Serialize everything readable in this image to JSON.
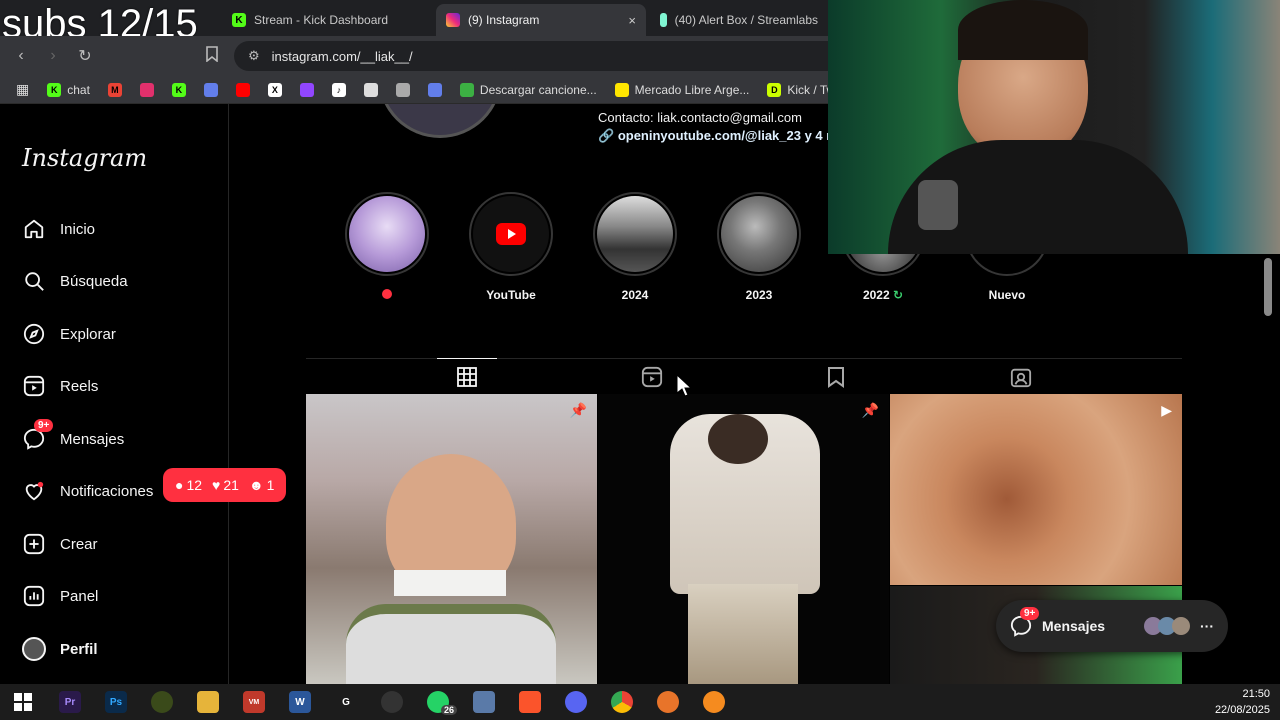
{
  "overlay": {
    "subs": "subs 12/15"
  },
  "browser": {
    "tabs": [
      {
        "title": "Stream - Kick Dashboard"
      },
      {
        "title": "(9) Instagram",
        "active": true
      },
      {
        "title": "(40) Alert Box / Streamlabs"
      }
    ],
    "tab_close": "×",
    "url": "instagram.com/__liak__/",
    "bookmarks": [
      {
        "label": "chat"
      },
      {
        "label": "Descargar cancione..."
      },
      {
        "label": "Mercado Libre Arge..."
      },
      {
        "label": "Kick / Twitch VC"
      }
    ]
  },
  "sidebar": {
    "logo": "Instagram",
    "items": [
      {
        "label": "Inicio",
        "icon": "home-icon"
      },
      {
        "label": "Búsqueda",
        "icon": "search-icon"
      },
      {
        "label": "Explorar",
        "icon": "compass-icon"
      },
      {
        "label": "Reels",
        "icon": "reels-icon"
      },
      {
        "label": "Mensajes",
        "icon": "messenger-icon",
        "badge": "9+"
      },
      {
        "label": "Notificaciones",
        "icon": "heart-icon"
      },
      {
        "label": "Crear",
        "icon": "plus-square-icon"
      },
      {
        "label": "Panel",
        "icon": "chart-icon"
      },
      {
        "label": "Perfil",
        "icon": "avatar"
      }
    ],
    "notifications": {
      "comments": "12",
      "likes": "21",
      "followers": "1"
    }
  },
  "profile": {
    "contact": "Contacto: liak.contacto@gmail.com",
    "link": "openinyoutube.com/@liak_23 y 4 m",
    "highlights": [
      {
        "label": ""
      },
      {
        "label": "YouTube"
      },
      {
        "label": "2024"
      },
      {
        "label": "2023"
      },
      {
        "label": "2022"
      },
      {
        "label": "Nuevo"
      }
    ]
  },
  "messages_pill": {
    "label": "Mensajes",
    "badge": "9+"
  },
  "taskbar": {
    "whatsapp_badge": "26",
    "time": "21:50",
    "date": "22/08/2025"
  },
  "colors": {
    "accent_red": "#ff3040",
    "bg": "#000000",
    "chrome": "#35363a"
  }
}
